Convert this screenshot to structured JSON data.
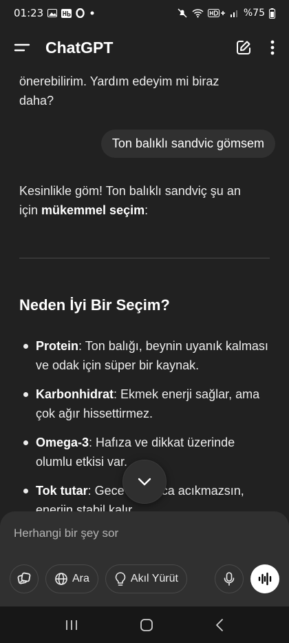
{
  "status": {
    "time": "01:23",
    "battery": "%75"
  },
  "header": {
    "title": "ChatGPT"
  },
  "chat": {
    "assistant_prev": "önerebilirim. Yardım edeyim mi biraz daha?",
    "user_message": "Ton balıklı sandvic gömsem",
    "assistant_intro_1": "Kesinlikle göm! Ton balıklı sandviç şu an için ",
    "assistant_intro_bold": "mükemmel seçim",
    "assistant_intro_2": ":",
    "heading": "Neden İyi Bir Seçim?",
    "bullets": [
      {
        "term": "Protein",
        "text": ": Ton balığı, beynin uyanık kalması ve odak için süper bir kaynak."
      },
      {
        "term": "Karbonhidrat",
        "text": ": Ekmek enerji sağlar, ama çok ağır hissettirmez."
      },
      {
        "term": "Omega-3",
        "text": ": Hafıza ve dikkat üzerinde olumlu etkisi var."
      },
      {
        "term": "Tok tutar",
        "text": ": Gece boyunca acıkmazsın, enerjin stabil kalır."
      }
    ]
  },
  "composer": {
    "placeholder": "Herhangi bir şey sor",
    "search_label": "Ara",
    "reason_label": "Akıl Yürüt"
  }
}
